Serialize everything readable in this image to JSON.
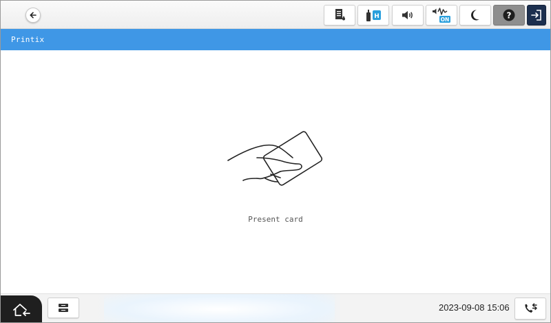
{
  "header": {
    "back_icon": "arrow-left-icon",
    "status_icons": [
      {
        "name": "ink-level-icon"
      },
      {
        "name": "network-status-icon"
      },
      {
        "name": "volume-icon"
      },
      {
        "name": "quiet-mode-icon",
        "badge": "ON"
      },
      {
        "name": "sleep-mode-icon"
      },
      {
        "name": "help-icon"
      },
      {
        "name": "logout-icon"
      }
    ]
  },
  "titlebar": {
    "title": "Printix",
    "color": "#3f97e6"
  },
  "main": {
    "illustration": "hand-holding-card-icon",
    "prompt": "Present card"
  },
  "footer": {
    "home_icon": "home-icon",
    "job_status_icon": "job-status-icon",
    "datetime": "2023-09-08 15:06",
    "fax_icon": "fax-contacts-icon"
  }
}
